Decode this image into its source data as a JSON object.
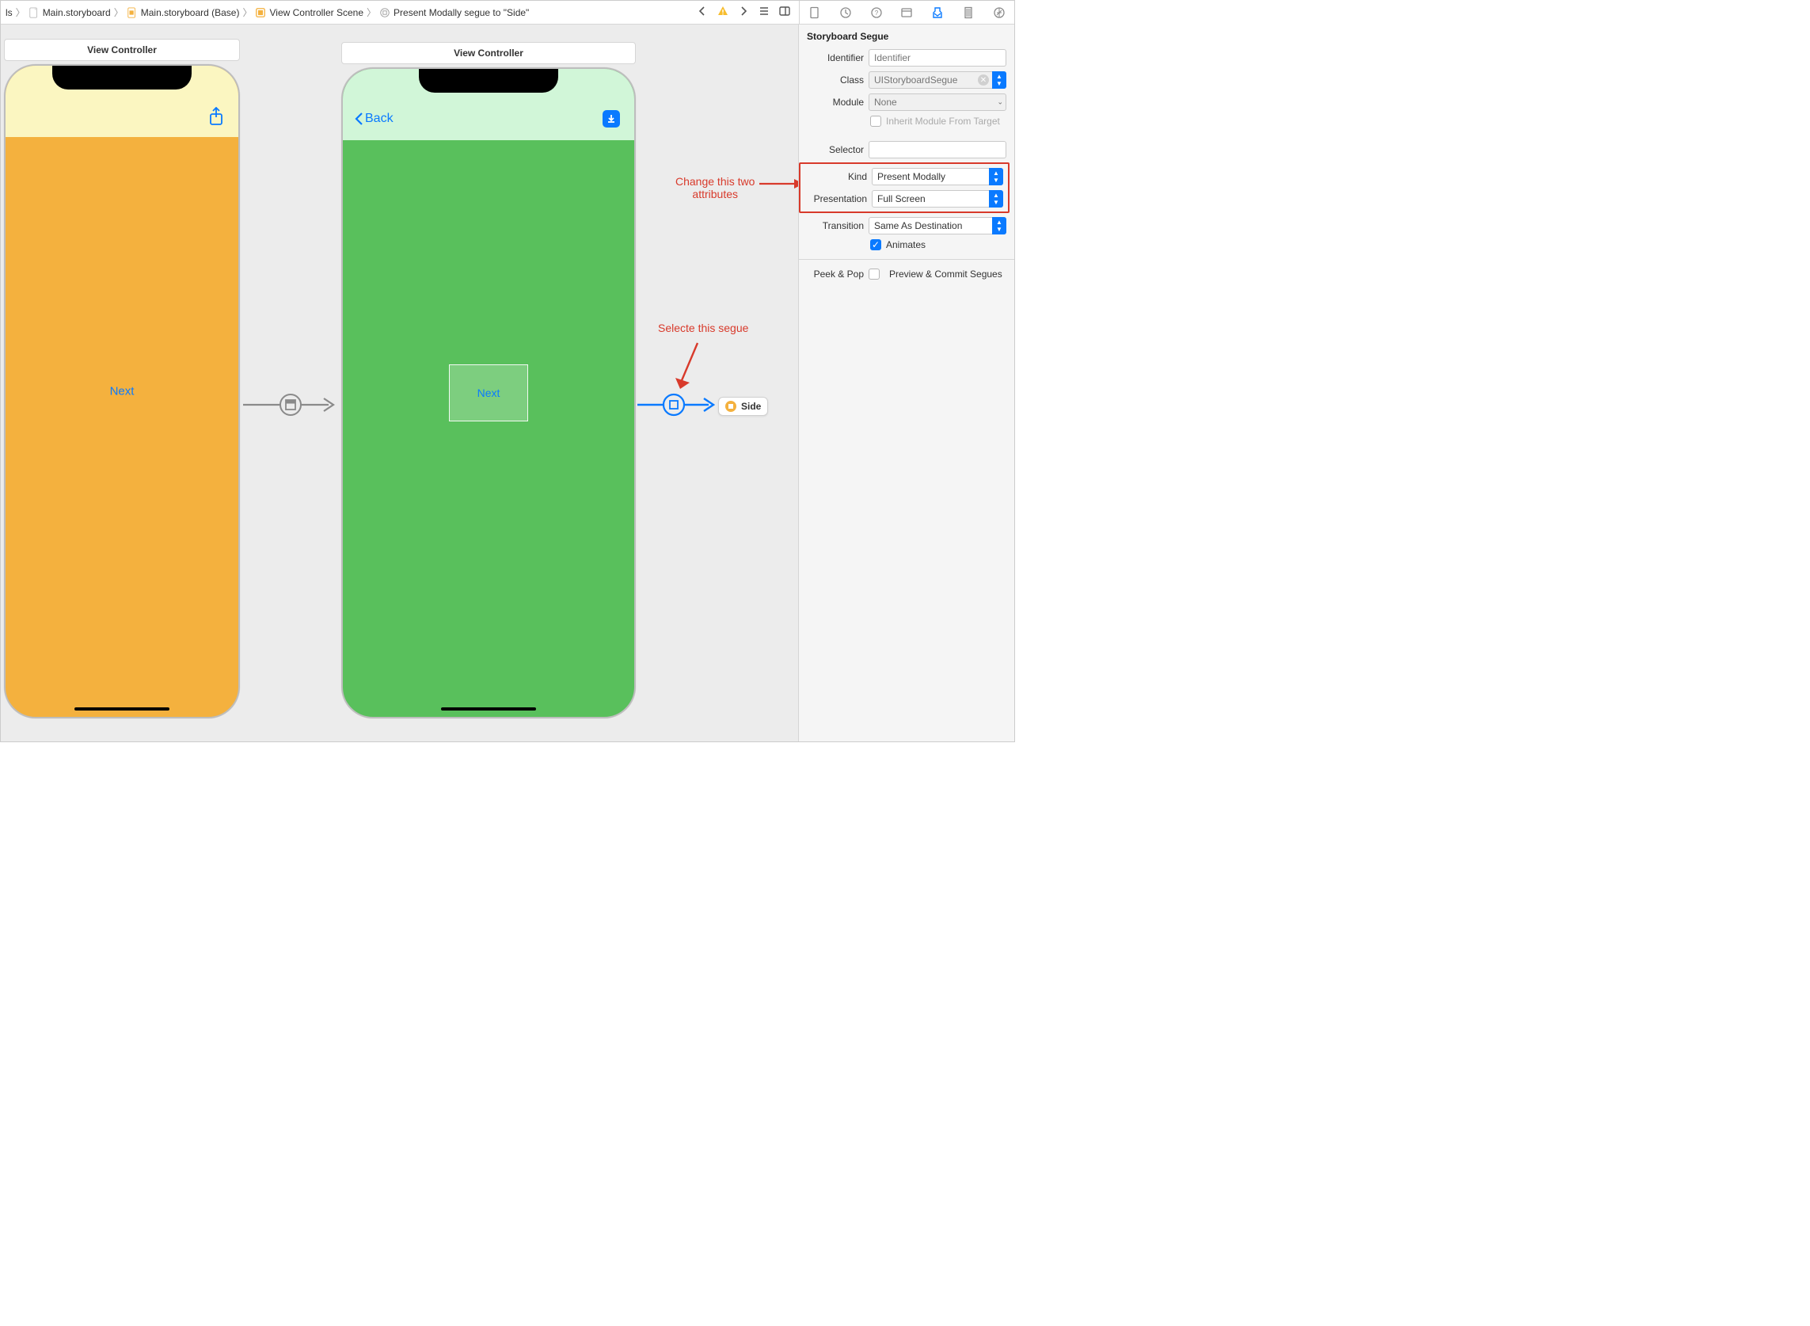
{
  "breadcrumb": {
    "item0": "ls",
    "item1": "Main.storyboard",
    "item2": "Main.storyboard (Base)",
    "item3": "View Controller Scene",
    "item4": "Present Modally segue to \"Side\""
  },
  "scenes": {
    "vc1_title": "View Controller",
    "vc2_title": "View Controller",
    "back_label": "Back",
    "next1": "Next",
    "next2": "Next",
    "side_pill": "Side"
  },
  "annotations": {
    "select_segue": "Selecte this segue",
    "change_attrs": "Change this two\nattributes"
  },
  "inspector": {
    "section_title": "Storyboard Segue",
    "labels": {
      "identifier": "Identifier",
      "class": "Class",
      "module": "Module",
      "inherit": "Inherit Module From Target",
      "selector": "Selector",
      "kind": "Kind",
      "presentation": "Presentation",
      "transition": "Transition",
      "animates": "Animates",
      "peek_pop": "Peek & Pop",
      "preview_commit": "Preview & Commit Segues"
    },
    "values": {
      "identifier_placeholder": "Identifier",
      "class_placeholder": "UIStoryboardSegue",
      "module_placeholder": "None",
      "selector": "",
      "kind": "Present Modally",
      "presentation": "Full Screen",
      "transition": "Same As Destination"
    }
  },
  "colors": {
    "accent": "#0a7aff",
    "orange": "#f4b13e",
    "red": "#d83a2b",
    "green_body": "#59c05c",
    "green_top": "#d1f6d8",
    "yellow_body": "#f4b13e",
    "yellow_top": "#fbf6c1"
  }
}
